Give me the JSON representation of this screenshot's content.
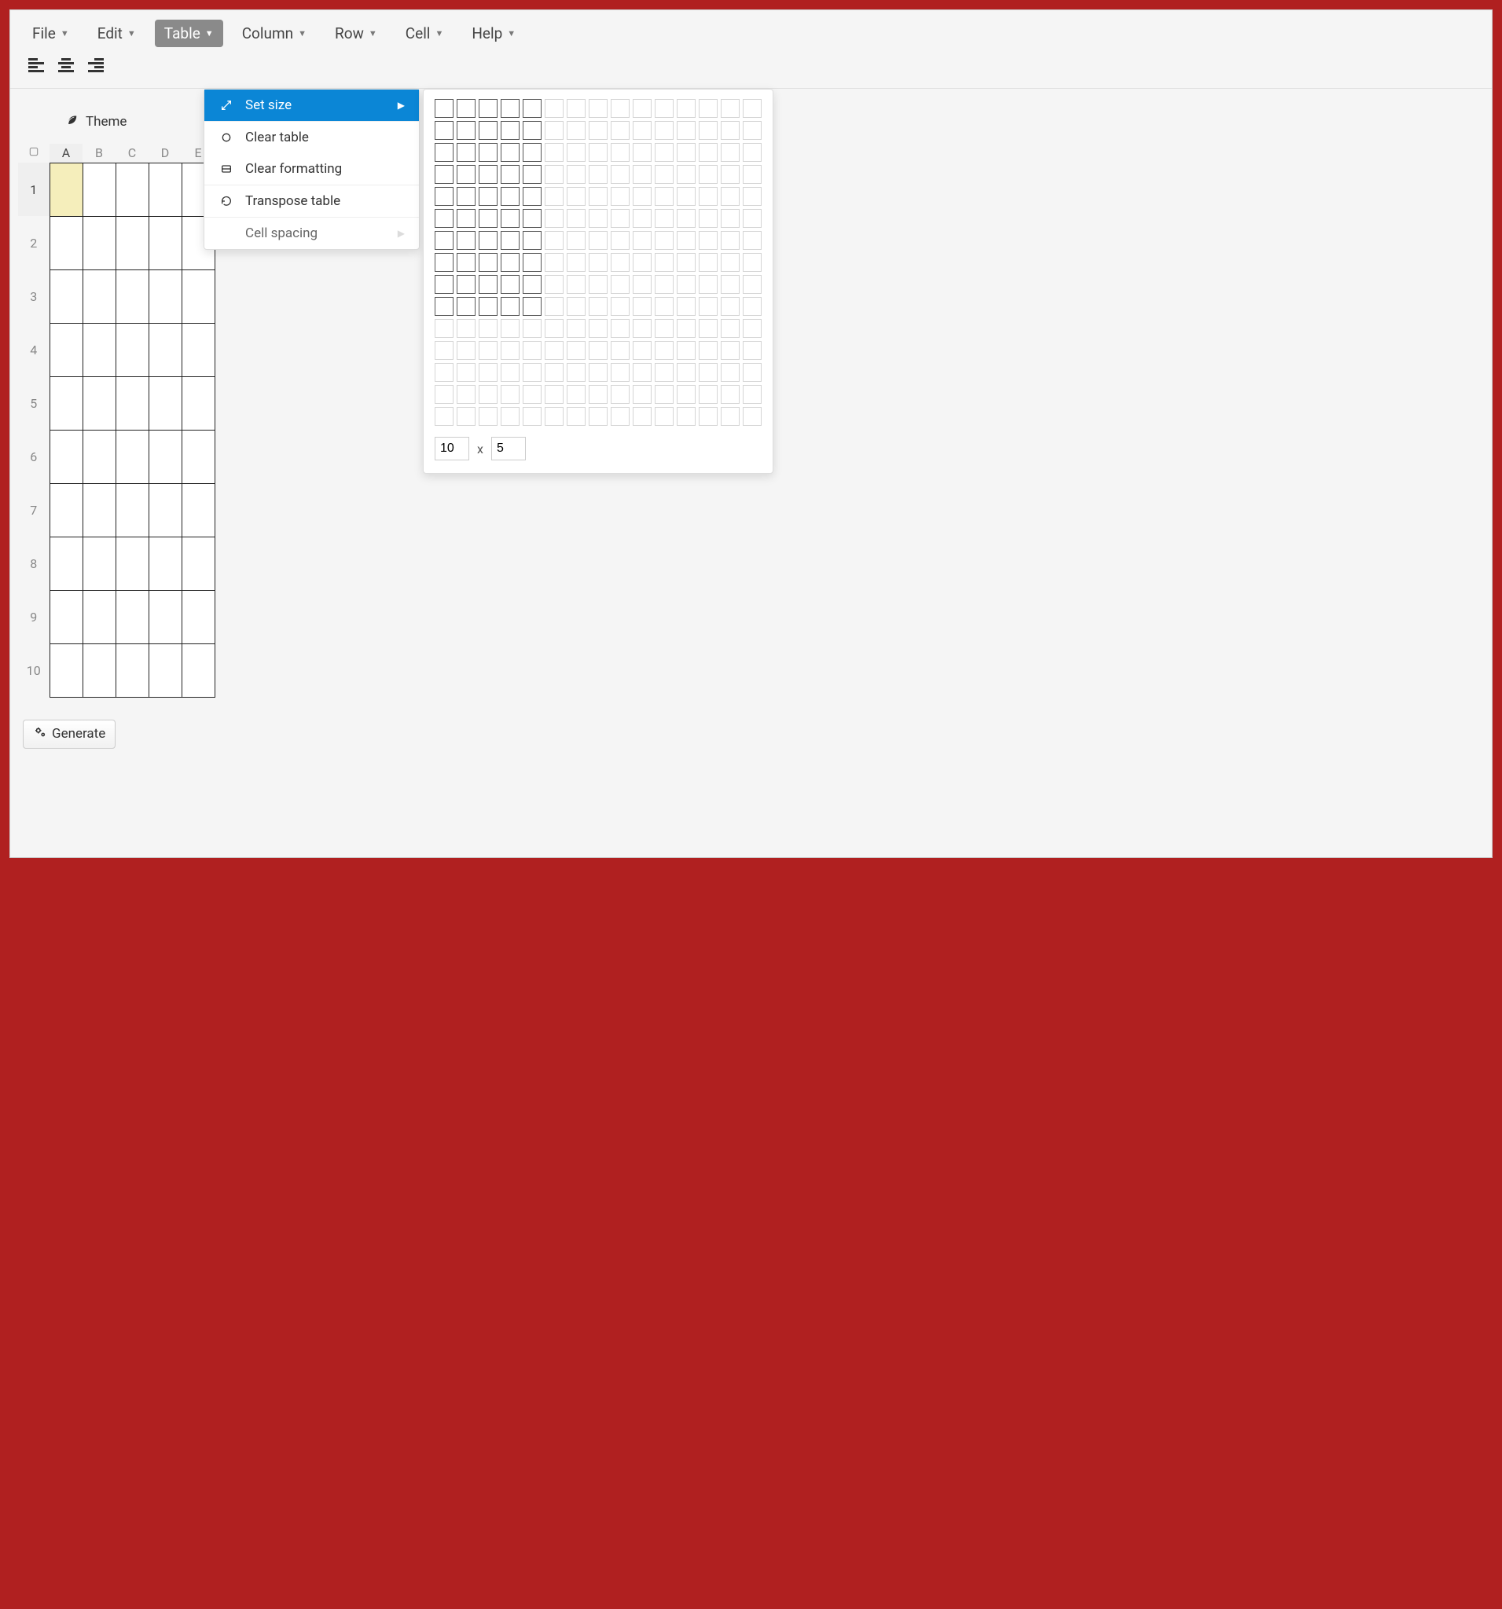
{
  "menubar": {
    "items": [
      {
        "label": "File"
      },
      {
        "label": "Edit"
      },
      {
        "label": "Table",
        "active": true
      },
      {
        "label": "Column"
      },
      {
        "label": "Row"
      },
      {
        "label": "Cell"
      },
      {
        "label": "Help"
      }
    ]
  },
  "toolbar": {
    "theme_label": "Theme"
  },
  "table_menu": {
    "set_size": "Set size",
    "clear_table": "Clear table",
    "clear_formatting": "Clear formatting",
    "transpose": "Transpose table",
    "cell_spacing": "Cell spacing"
  },
  "size_picker": {
    "grid_cols": 15,
    "grid_rows": 15,
    "selected_cols": 5,
    "selected_rows": 10,
    "rows_value": "10",
    "columns_value": "5"
  },
  "sheet": {
    "columns": [
      "A",
      "B",
      "C",
      "D",
      "E"
    ],
    "rows": [
      "1",
      "2",
      "3",
      "4",
      "5",
      "6",
      "7",
      "8",
      "9",
      "10"
    ],
    "active_cell": {
      "row": 0,
      "col": 0
    }
  },
  "generate_label": "Generate"
}
